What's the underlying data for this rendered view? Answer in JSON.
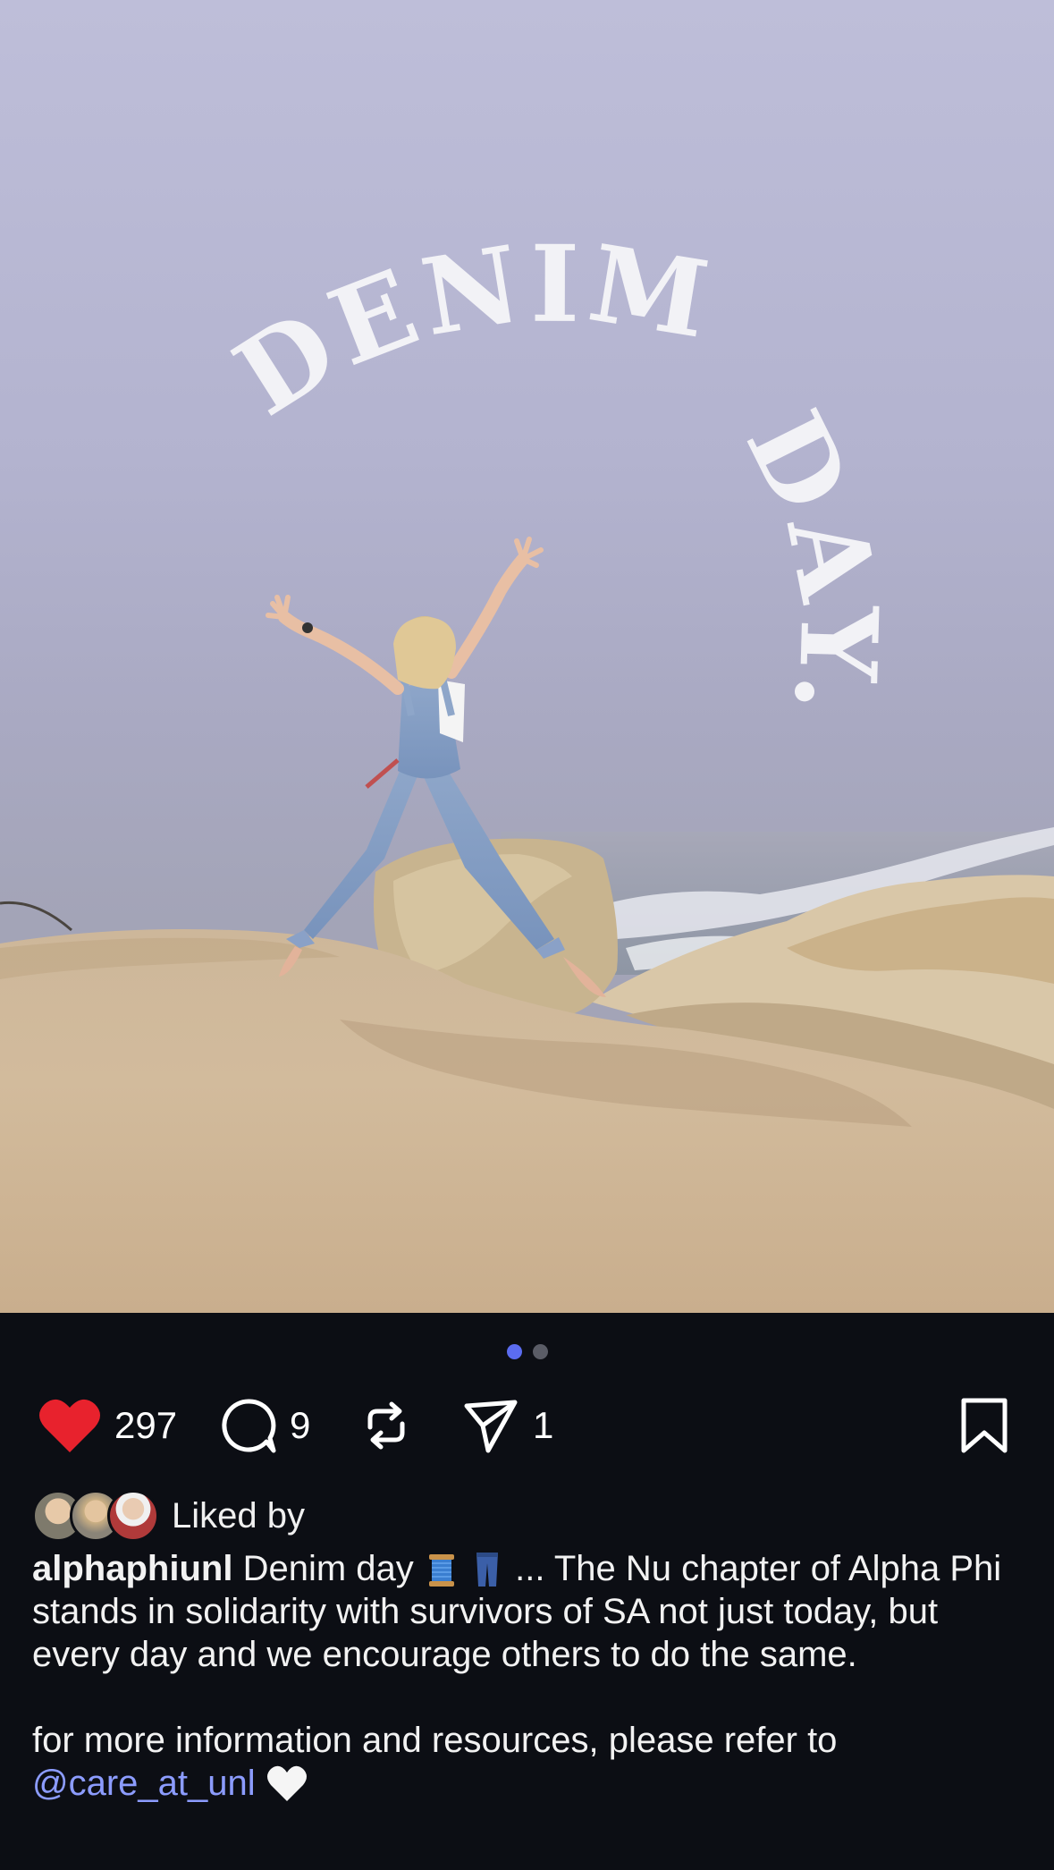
{
  "post": {
    "overlay_text_1": "DENIM",
    "overlay_text_2": "DAY."
  },
  "carousel": {
    "count": 2,
    "active": 0
  },
  "actions": {
    "likes": "297",
    "comments": "9",
    "shares": "1"
  },
  "liked_by": {
    "label": "Liked by"
  },
  "caption": {
    "username": "alphaphiunl",
    "text_start": "Denim day",
    "text_main": "... The Nu chapter of Alpha Phi stands in solidarity with survivors of SA not just today, but every day and we encourage others to do the same.",
    "text_more": "for more information and resources, please refer to",
    "mention": "@care_at_unl"
  },
  "colors": {
    "like": "#e8222d",
    "mention": "#8c9cff",
    "background": "#0c0e14",
    "active_dot": "#5b6cf0"
  },
  "icons": [
    "heart-icon",
    "comment-icon",
    "repost-icon",
    "send-icon",
    "bookmark-icon",
    "spool-emoji",
    "jeans-emoji",
    "white-heart-emoji"
  ]
}
